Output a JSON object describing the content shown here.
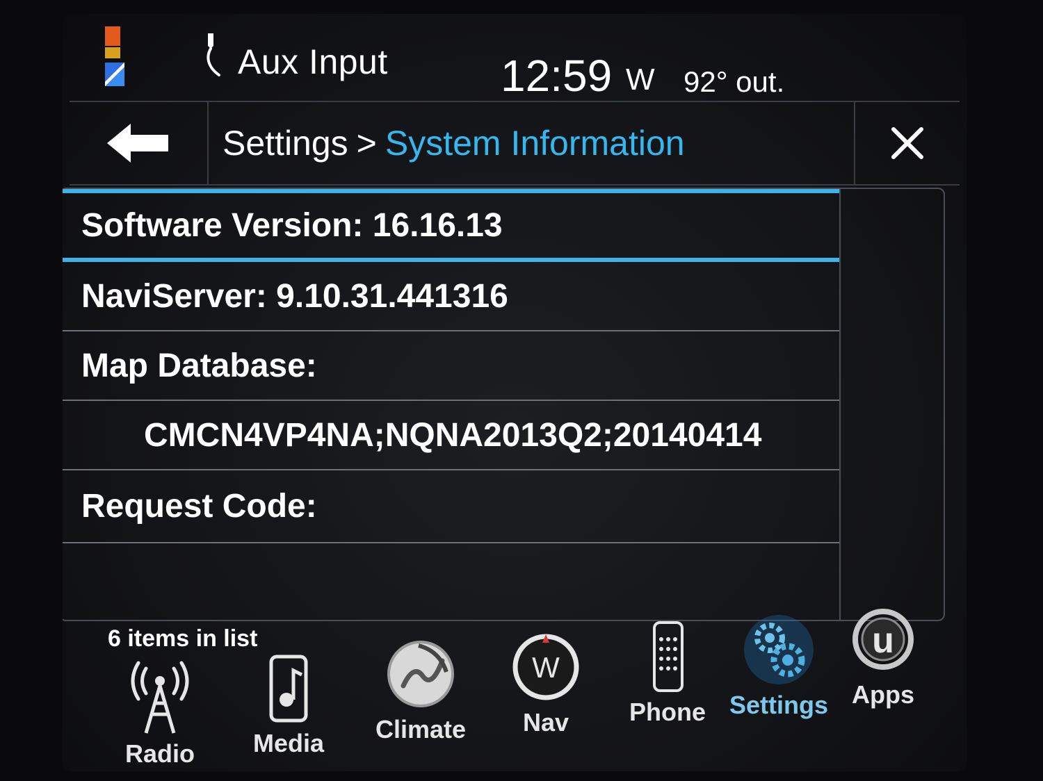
{
  "status": {
    "source_label": "Aux Input",
    "clock": "12:59",
    "compass": "W",
    "temperature": "92° out."
  },
  "header": {
    "breadcrumb_parent": "Settings",
    "breadcrumb_separator": ">",
    "breadcrumb_current": "System Information"
  },
  "list": {
    "rows": [
      {
        "label": "Software Version: 16.16.13"
      },
      {
        "label": "NaviServer: 9.10.31.441316"
      },
      {
        "label": "Map Database:"
      },
      {
        "label": "CMCN4VP4NA;NQNA2013Q2;20140414"
      },
      {
        "label": "Request Code:"
      },
      {
        "label": ""
      }
    ],
    "item_count": "6 items in list"
  },
  "nav": {
    "radio": "Radio",
    "media": "Media",
    "climate": "Climate",
    "nav": "Nav",
    "nav_icon_letter": "W",
    "phone": "Phone",
    "settings": "Settings",
    "apps": "Apps"
  },
  "colors": {
    "accent": "#35b7f0",
    "selection": "#3bb4ec",
    "background": "#131417"
  }
}
